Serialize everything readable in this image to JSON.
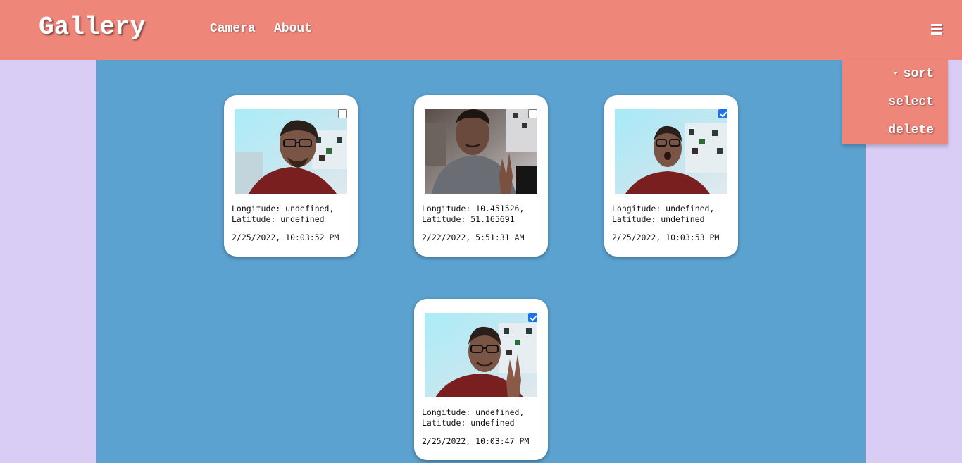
{
  "navbar": {
    "brand": "Gallery",
    "links": [
      {
        "label": "Camera"
      },
      {
        "label": "About"
      }
    ],
    "menu_icon": "hamburger-icon",
    "color": "#ef867a"
  },
  "dropdown": {
    "sort_caret": "▾",
    "sort": "sort",
    "select": "select",
    "delete": "delete"
  },
  "colors": {
    "page_bg": "#d9ccf5",
    "main_bg": "#5ca2d0",
    "checkbox_checked": "#1a73e8"
  },
  "cards": [
    {
      "coords": "Longitude: undefined, Latitude: undefined",
      "date": "2/25/2022, 10:03:52 PM",
      "checked": false
    },
    {
      "coords": "Longitude: 10.451526, Latitude: 51.165691",
      "date": "2/22/2022, 5:51:31 AM",
      "checked": false
    },
    {
      "coords": "Longitude: undefined, Latitude: undefined",
      "date": "2/25/2022, 10:03:53 PM",
      "checked": true
    },
    {
      "coords": "Longitude: undefined, Latitude: undefined",
      "date": "2/25/2022, 10:03:47 PM",
      "checked": true
    }
  ]
}
